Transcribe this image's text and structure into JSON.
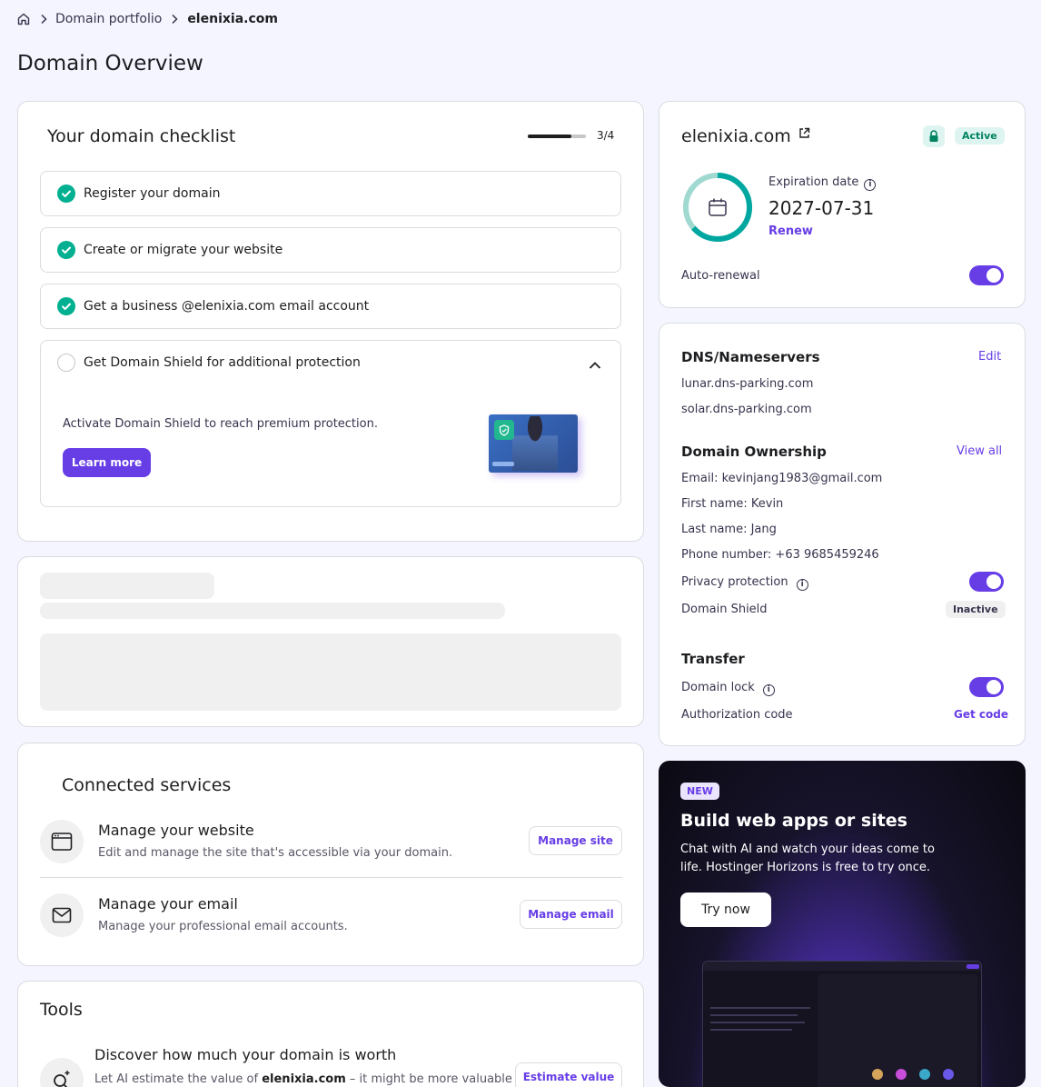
{
  "breadcrumb": {
    "home_icon": "home-icon",
    "portfolio": "Domain portfolio",
    "current": "elenixia.com"
  },
  "page_title": "Domain Overview",
  "checklist": {
    "title": "Your domain checklist",
    "progress": "3/4",
    "progress_fraction": 0.75,
    "items": [
      {
        "label": "Register your domain",
        "done": true
      },
      {
        "label": "Create or migrate your website",
        "done": true
      },
      {
        "label": "Get a business @elenixia.com email account",
        "done": true
      },
      {
        "label": "Get Domain Shield for additional protection",
        "done": false
      }
    ],
    "shield_text": "Activate Domain Shield to reach premium protection.",
    "learn_more": "Learn more"
  },
  "services": {
    "title": "Connected services",
    "website": {
      "title": "Manage your website",
      "desc": "Edit and manage the site that's accessible via your domain.",
      "button": "Manage site"
    },
    "email": {
      "title": "Manage your email",
      "desc": "Manage your professional email accounts.",
      "button": "Manage email"
    }
  },
  "tools": {
    "title": "Tools",
    "worth_title": "Discover how much your domain is worth",
    "worth_desc_pre": "Let AI estimate the value of ",
    "worth_domain": "elenixia.com",
    "worth_desc_post": " – it might be more valuable",
    "button": "Estimate value"
  },
  "domain_card": {
    "name": "elenixia.com",
    "status": "Active",
    "expiration_label": "Expiration date",
    "expiration_date": "2027-07-31",
    "renew": "Renew",
    "auto_renewal": "Auto-renewal",
    "auto_renewal_on": true
  },
  "dns": {
    "title": "DNS/Nameservers",
    "edit": "Edit",
    "ns1": "lunar.dns-parking.com",
    "ns2": "solar.dns-parking.com"
  },
  "ownership": {
    "title": "Domain Ownership",
    "view_all": "View all",
    "email": "Email: kevinjang1983@gmail.com",
    "first_name": "First name: Kevin",
    "last_name": "Last name: Jang",
    "phone": "Phone number: +63 9685459246",
    "privacy": "Privacy protection",
    "privacy_on": true,
    "shield": "Domain Shield",
    "shield_status": "Inactive"
  },
  "transfer": {
    "title": "Transfer",
    "lock": "Domain lock",
    "lock_on": true,
    "auth_code": "Authorization code",
    "get_code": "Get code"
  },
  "promo": {
    "badge": "NEW",
    "title": "Build web apps or sites",
    "text1": "Chat with AI and watch your ideas come to",
    "text2": "life. Hostinger Horizons is free to try once.",
    "button": "Try now"
  },
  "colors": {
    "accent": "#673de6",
    "success": "#00b090",
    "text": "#1d1e20"
  }
}
